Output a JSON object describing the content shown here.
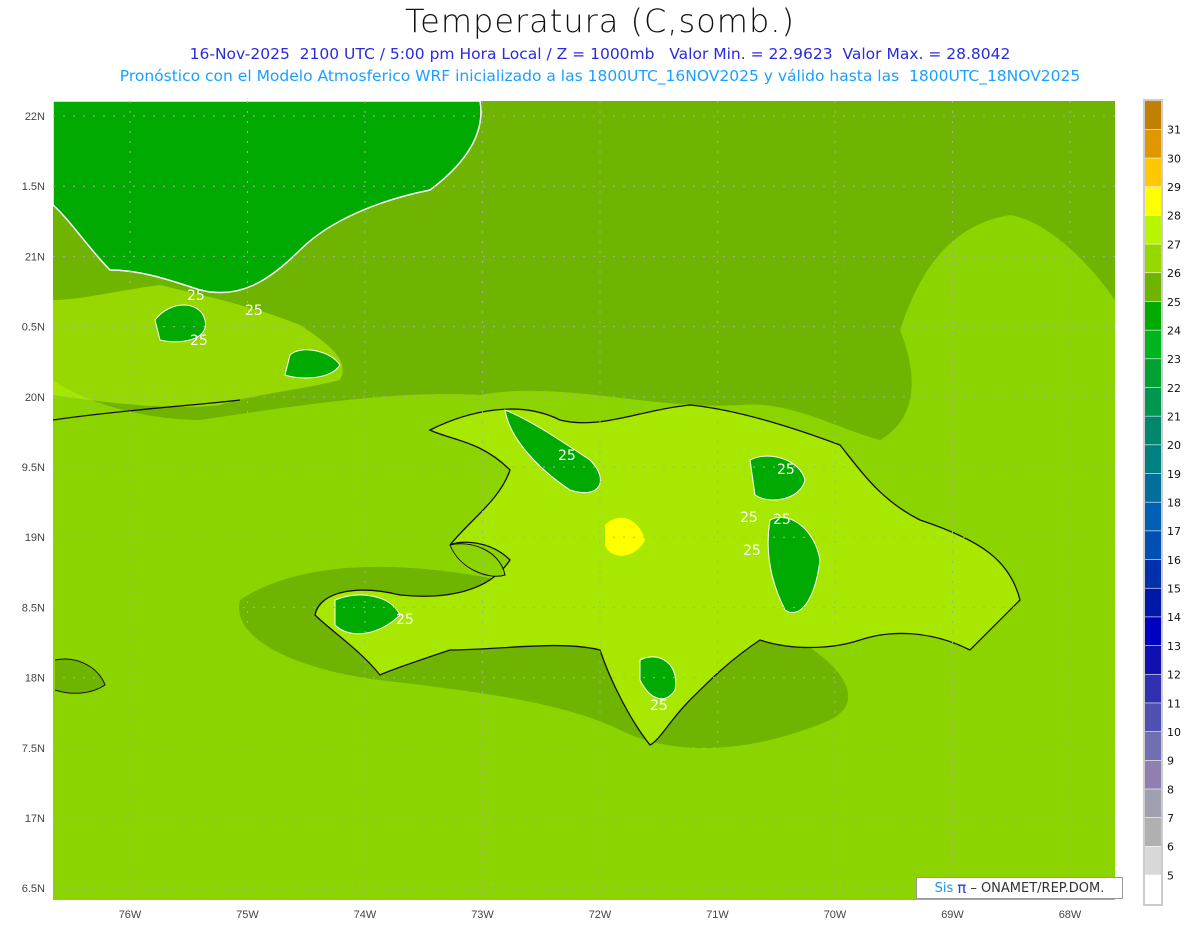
{
  "header": {
    "title": "Temperatura (C,somb.)",
    "line1": "16-Nov-2025  2100 UTC / 5:00 pm Hora Local / Z = 1000mb   Valor Min. = 22.9623  Valor Max. = 28.8042",
    "line2": "Pronóstico con el Modelo Atmosferico WRF inicializado a las 1800UTC_16NOV2025 y válido hasta las  1800UTC_18NOV2025"
  },
  "chart_data": {
    "type": "heatmap",
    "title": "Temperatura (C,somb.)",
    "variable": "Temperature (C) at 1000mb",
    "value_min": 22.9623,
    "value_max": 28.8042,
    "x_ticks": [
      "76W",
      "75W",
      "74W",
      "73W",
      "72W",
      "71W",
      "70W",
      "69W",
      "68W"
    ],
    "y_ticks": [
      "22N",
      "1.5N",
      "21N",
      "0.5N",
      "20N",
      "9.5N",
      "19N",
      "8.5N",
      "18N",
      "7.5N",
      "17N",
      "6.5N"
    ],
    "lon_range": [
      -76.65,
      -67.6
    ],
    "lat_range": [
      17.45,
      22.1
    ],
    "contour_labels": [
      "25",
      "25",
      "25",
      "25",
      "25",
      "25",
      "25",
      "25",
      "25",
      "25"
    ],
    "colorbar": {
      "labels": [
        "31",
        "30",
        "29",
        "28",
        "27",
        "26",
        "25",
        "24",
        "23",
        "22",
        "21",
        "20",
        "19",
        "18",
        "17",
        "16",
        "15",
        "14",
        "13",
        "12",
        "11",
        "10",
        "9",
        "8",
        "7",
        "6",
        "5"
      ],
      "colors": [
        "#c08000",
        "#e09800",
        "#ffc800",
        "#ffff00",
        "#b9f500",
        "#96d700",
        "#6eb400",
        "#00aa00",
        "#00b41e",
        "#00a032",
        "#009650",
        "#00876e",
        "#008080",
        "#00709a",
        "#0060b4",
        "#0050b4",
        "#0030aa",
        "#0018a8",
        "#0000c0",
        "#1010b0",
        "#3030b0",
        "#5050b0",
        "#7070b0",
        "#9080b0",
        "#a0a0b0",
        "#b0b0b0",
        "#d8d8d8",
        "#ffffff"
      ]
    }
  },
  "footer": {
    "logo_sis": "Sis",
    "logo_pi": "π",
    "logo_text": "– ONAMET/REP.DOM."
  }
}
